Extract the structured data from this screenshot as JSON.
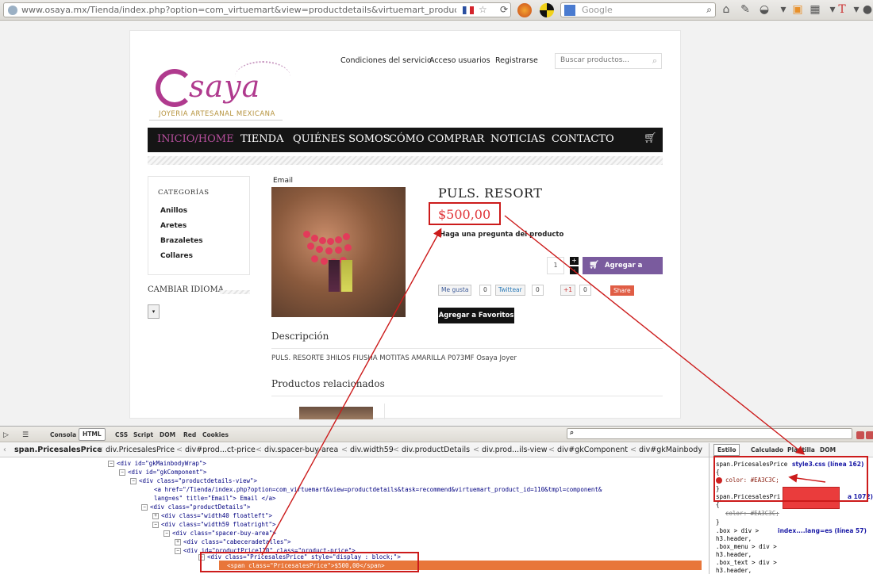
{
  "browser": {
    "url": "www.osaya.mx/Tienda/index.php?option=com_virtuemart&view=productdetails&virtuemart_product_id=110&virtuem",
    "search_placeholder": "Google"
  },
  "header": {
    "logo_name": "saya",
    "logo_tagline": "JOYERIA ARTESANAL MEXICANA",
    "links": [
      "Condiciones del servicio",
      "Acceso usuarios",
      "Registrarse"
    ],
    "search_placeholder": "Buscar productos..."
  },
  "nav": {
    "items": [
      "INICIO/HOME",
      "TIENDA",
      "QUIÉNES SOMOS",
      "CÓMO COMPRAR",
      "NOTICIAS",
      "CONTACTO"
    ],
    "active_index": 0
  },
  "sidebar": {
    "categories_title": "CATEGORÍAS",
    "categories": [
      "Anillos",
      "Aretes",
      "Brazaletes",
      "Collares"
    ],
    "language_title": "CAMBIAR IDIOMA"
  },
  "product": {
    "email_label": "Email",
    "title": "PULS. RESORT",
    "price": "$500,00",
    "ask_link": "Haga una pregunta del producto",
    "quantity": "1",
    "add_to_cart": "Agregar a carro",
    "facebook_label": "Me gusta",
    "facebook_count": "0",
    "twitter_label": "Twittear",
    "twitter_count": "0",
    "gplus_label": "+1",
    "gplus_count": "0",
    "share_label": "Share",
    "favorites": "Agregar a Favoritos",
    "description_title": "Descripción",
    "description_text": "PULS. RESORTE 3HILOS FIUSHA MOTITAS AMARILLA P073MF Osaya Joyer",
    "related_title": "Productos relacionados"
  },
  "firebug": {
    "tabs": [
      "Consola",
      "HTML",
      "CSS",
      "Script",
      "DOM",
      "Red",
      "Cookies"
    ],
    "active_tab": "HTML",
    "breadcrumbs": [
      "span.PricesalesPrice",
      "div.PricesalesPrice",
      "div#prod...ct-price",
      "div.spacer-buy-area",
      "div.width59",
      "div.productDetails",
      "div.prod...ils-view",
      "div#gkComponent",
      "div#gkMainbody"
    ],
    "side_tabs": [
      "Estilo",
      "Calculado",
      "Plantilla",
      "DOM"
    ],
    "tree": [
      "<div id=\"gkMainbodyWrap\">",
      "<div id=\"gkComponent\">",
      "<div class=\"productdetails-view\">",
      "<a href=\"/Tienda/index.php?option=com_virtuemart&view=productdetails&task=recommend&virtuemart_product_id=110&tmpl=component&",
      "lang=es\" title=\"Email\"> Email </a>",
      "<div class=\"productDetails\">",
      "<div class=\"width40 floatleft\">",
      "<div class=\"width59 floatright\">",
      "<div class=\"spacer-buy-area\">",
      "<div class=\"cabeceradetalles\">",
      "<div id=\"productPrice110\" class=\"product-price\">",
      "<div class=\"PricesalesPrice\" style=\"display : block;\">",
      "<span class=\"PricesalesPrice\">$500,00</span>"
    ],
    "css": {
      "rule1_selector": "span.PricesalesPrice",
      "rule1_source": "style3.css (línea 162)",
      "rule1_prop": "color: #EA3C3C;",
      "rule2_selector": "span.PricesalesPri",
      "rule2_source": "a 1072)",
      "rule2_prop": "color: #EA3C3C;",
      "rule3_selectors": [
        ".box > div >",
        "h3.header,",
        ".box_menu > div >",
        "h3.header,",
        ".box_text > div >",
        "h3.header,"
      ],
      "rule3_source": "index....lang=es (línea 57)"
    },
    "swatch_color": "#EA3C3C"
  },
  "colors": {
    "price": "#e0353a",
    "brand": "#b03a8e",
    "cart_button": "#7a5b9e",
    "annotation": "#cc1b1b"
  }
}
